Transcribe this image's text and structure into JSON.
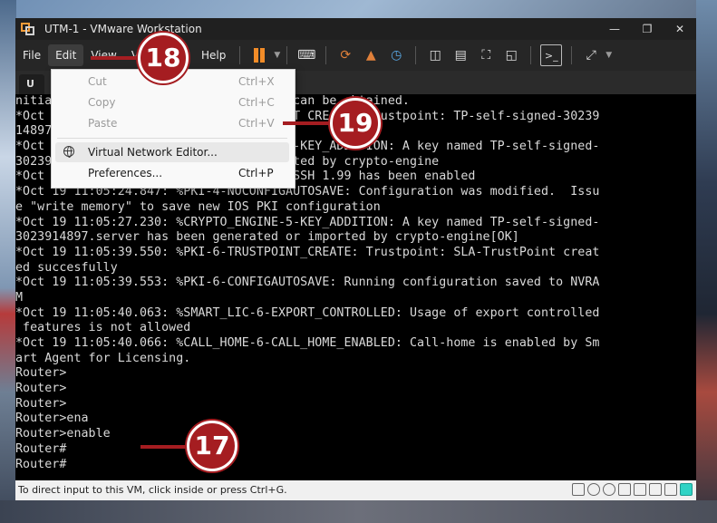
{
  "window": {
    "title": "UTM-1 - VMware Workstation"
  },
  "menubar": {
    "items": [
      "File",
      "Edit",
      "View",
      "VM",
      "Tabs",
      "Help"
    ]
  },
  "tab": {
    "label": "U"
  },
  "edit_menu": {
    "cut": {
      "label": "Cut",
      "shortcut": "Ctrl+X"
    },
    "copy": {
      "label": "Copy",
      "shortcut": "Ctrl+C"
    },
    "paste": {
      "label": "Paste",
      "shortcut": "Ctrl+V"
    },
    "vne": {
      "label": "Virtual Network Editor..."
    },
    "prefs": {
      "label": "Preferences...",
      "shortcut": "Ctrl+P"
    }
  },
  "console": {
    "lines": [
      "nitialization, time source, like NTP, can be obtained.",
      "*Oct 19 11:05:24.633: %PKI-4-TRUSTPOINT_CREATE: Trustpoint: TP-self-signed-30239",
      "14897 has been generated",
      "*Oct 19 11:05:24.823: %CRYPTO_ENGINE-5-KEY_ADDITION: A key named TP-self-signed-",
      "3023914897 has been generated or imported by crypto-engine",
      "*Oct 19 11:05:24.823: %SSH-5-ENABLED: SSH 1.99 has been enabled",
      "*Oct 19 11:05:24.847: %PKI-4-NOCONFIGAUTOSAVE: Configuration was modified.  Issu",
      "e \"write memory\" to save new IOS PKI configuration",
      "*Oct 19 11:05:27.230: %CRYPTO_ENGINE-5-KEY_ADDITION: A key named TP-self-signed-",
      "3023914897.server has been generated or imported by crypto-engine[OK]",
      "*Oct 19 11:05:39.550: %PKI-6-TRUSTPOINT_CREATE: Trustpoint: SLA-TrustPoint creat",
      "ed succesfully",
      "*Oct 19 11:05:39.553: %PKI-6-CONFIGAUTOSAVE: Running configuration saved to NVRA",
      "M",
      "*Oct 19 11:05:40.063: %SMART_LIC-6-EXPORT_CONTROLLED: Usage of export controlled",
      " features is not allowed",
      "*Oct 19 11:05:40.066: %CALL_HOME-6-CALL_HOME_ENABLED: Call-home is enabled by Sm",
      "art Agent for Licensing.",
      "Router>",
      "Router>",
      "Router>",
      "Router>ena",
      "Router>enable",
      "Router#",
      "Router#"
    ]
  },
  "statusbar": {
    "text": "To direct input to this VM, click inside or press Ctrl+G."
  },
  "callouts": {
    "c17": "17",
    "c18": "18",
    "c19": "19"
  },
  "colors": {
    "accent": "#a51d21",
    "pause": "#f28c28"
  }
}
